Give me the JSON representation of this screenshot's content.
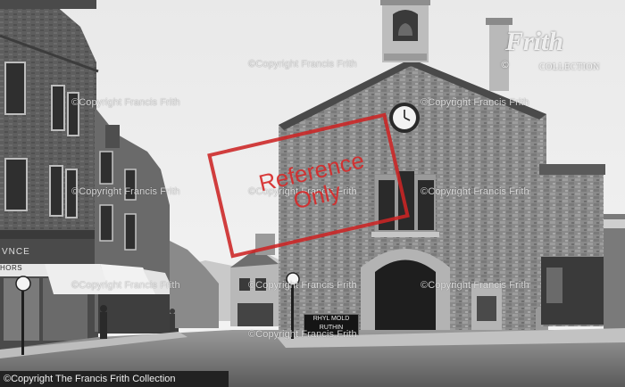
{
  "photo": {
    "watermarks": [
      "©Copyright Francis Frith",
      "©Copyright Francis Frith",
      "©Copyright Francis Frith",
      "©Copyright Francis Frith",
      "©Copyright Francis Frith",
      "©Copyright Francis Frith",
      "©Copyright Francis Frith",
      "©Copyright Francis Frith",
      "©Copyright Francis Frith",
      "©Copyright Francis Frith"
    ],
    "reference_stamp": {
      "line1": "Reference",
      "line2": "Only",
      "color": "#cc2424"
    },
    "logo": {
      "copyright": "©",
      "brand": "Frith",
      "sub": "COLLECTION"
    },
    "caption": "©Copyright The Francis Frith Collection",
    "road_sign": {
      "line1": "RHYL MOLD",
      "line2": "RUTHIN"
    },
    "shop_sign": "VNCE",
    "awning": "HORS"
  }
}
